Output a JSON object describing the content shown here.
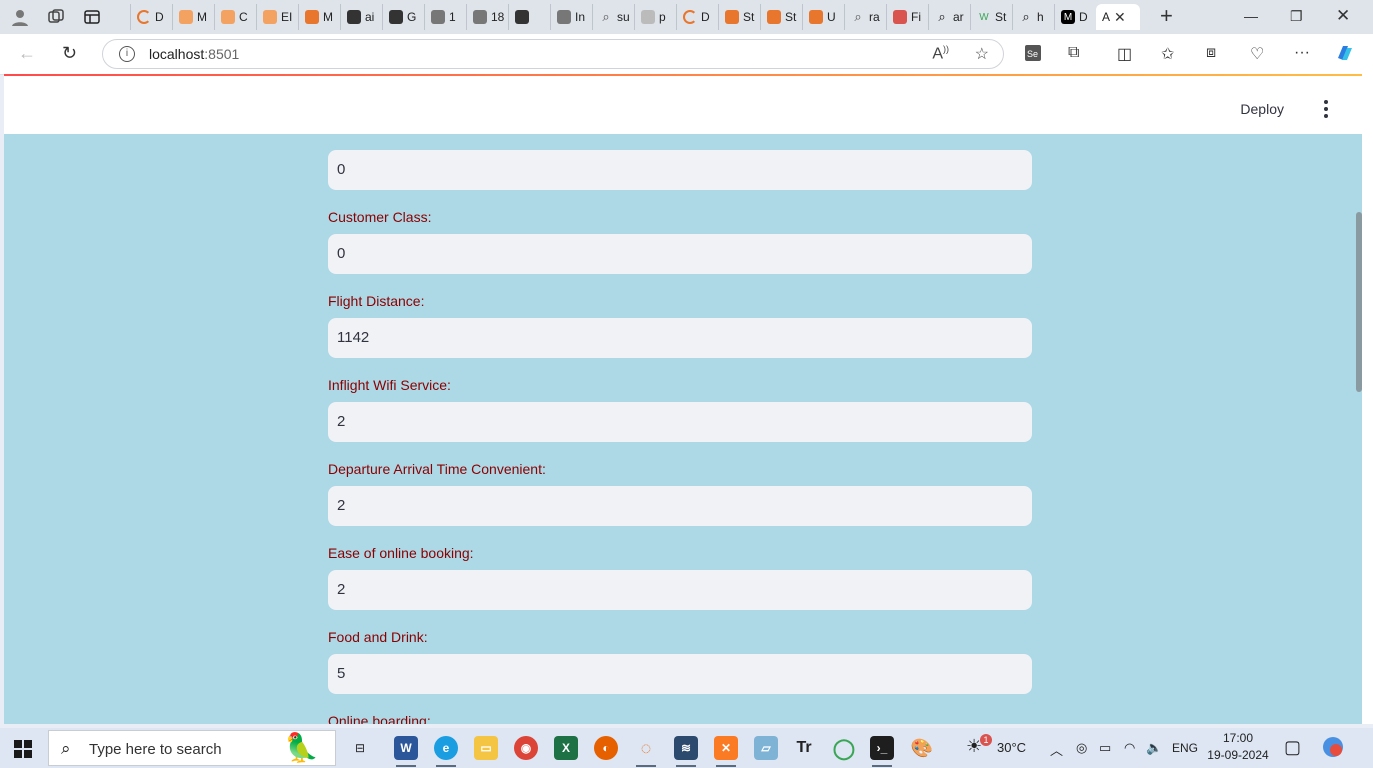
{
  "browser": {
    "tabs": [
      {
        "label": "D",
        "favicon": "loading-icon",
        "color": "#e8762c"
      },
      {
        "label": "M",
        "favicon": "book-icon",
        "color": "#f4a261"
      },
      {
        "label": "C",
        "favicon": "book-icon",
        "color": "#f4a261"
      },
      {
        "label": "EI",
        "favicon": "book-icon",
        "color": "#f4a261"
      },
      {
        "label": "M",
        "favicon": "book-icon",
        "color": "#e8762c"
      },
      {
        "label": "ai",
        "favicon": "github-icon",
        "color": "#333333"
      },
      {
        "label": "G",
        "favicon": "github-icon",
        "color": "#333333"
      },
      {
        "label": "1",
        "favicon": "file-icon",
        "color": "#777777"
      },
      {
        "label": "18",
        "favicon": "file-icon",
        "color": "#777777"
      },
      {
        "label": "",
        "favicon": "github-icon",
        "color": "#333333"
      },
      {
        "label": "In",
        "favicon": "file-icon",
        "color": "#777777"
      },
      {
        "label": "su",
        "favicon": "search-icon",
        "color": "#555555"
      },
      {
        "label": "p",
        "favicon": "book-icon",
        "color": "#bbbbbb"
      },
      {
        "label": "D",
        "favicon": "loading-icon",
        "color": "#e8762c"
      },
      {
        "label": "St",
        "favicon": "book-icon",
        "color": "#e8762c"
      },
      {
        "label": "St",
        "favicon": "book-icon",
        "color": "#e8762c"
      },
      {
        "label": "U",
        "favicon": "book-icon",
        "color": "#e8762c"
      },
      {
        "label": "ra",
        "favicon": "search-icon",
        "color": "#555555"
      },
      {
        "label": "Fi",
        "favicon": "pdf-icon",
        "color": "#d9534f"
      },
      {
        "label": "ar",
        "favicon": "search-icon",
        "color": "#111111"
      },
      {
        "label": "St",
        "favicon": "w-icon",
        "color": "#3aa655"
      },
      {
        "label": "h",
        "favicon": "search-icon",
        "color": "#111111"
      },
      {
        "label": "D",
        "favicon": "medium-icon",
        "color": "#000000"
      },
      {
        "label": "A",
        "favicon": "none",
        "color": "#ffffff",
        "active": true
      }
    ],
    "address": {
      "host": "localhost",
      "port": ":8501"
    }
  },
  "app": {
    "header": {
      "deploy_label": "Deploy"
    },
    "fields": [
      {
        "label": "",
        "value": "0"
      },
      {
        "label": "Customer Class:",
        "value": "0"
      },
      {
        "label": "Flight Distance:",
        "value": "1142"
      },
      {
        "label": "Inflight Wifi Service:",
        "value": "2"
      },
      {
        "label": "Departure Arrival Time Convenient:",
        "value": "2"
      },
      {
        "label": "Ease of online booking:",
        "value": "2"
      },
      {
        "label": "Food and Drink:",
        "value": "5"
      },
      {
        "label": "Online boarding:",
        "value": ""
      }
    ]
  },
  "taskbar": {
    "search_placeholder": "Type here to search",
    "weather": "30°C",
    "language": "ENG",
    "time": "17:00",
    "date": "19-09-2024",
    "weather_badge": "1"
  },
  "colors": {
    "main_bg": "#add8e6",
    "label_color": "#8b0000",
    "input_bg": "#f0f2f6"
  }
}
